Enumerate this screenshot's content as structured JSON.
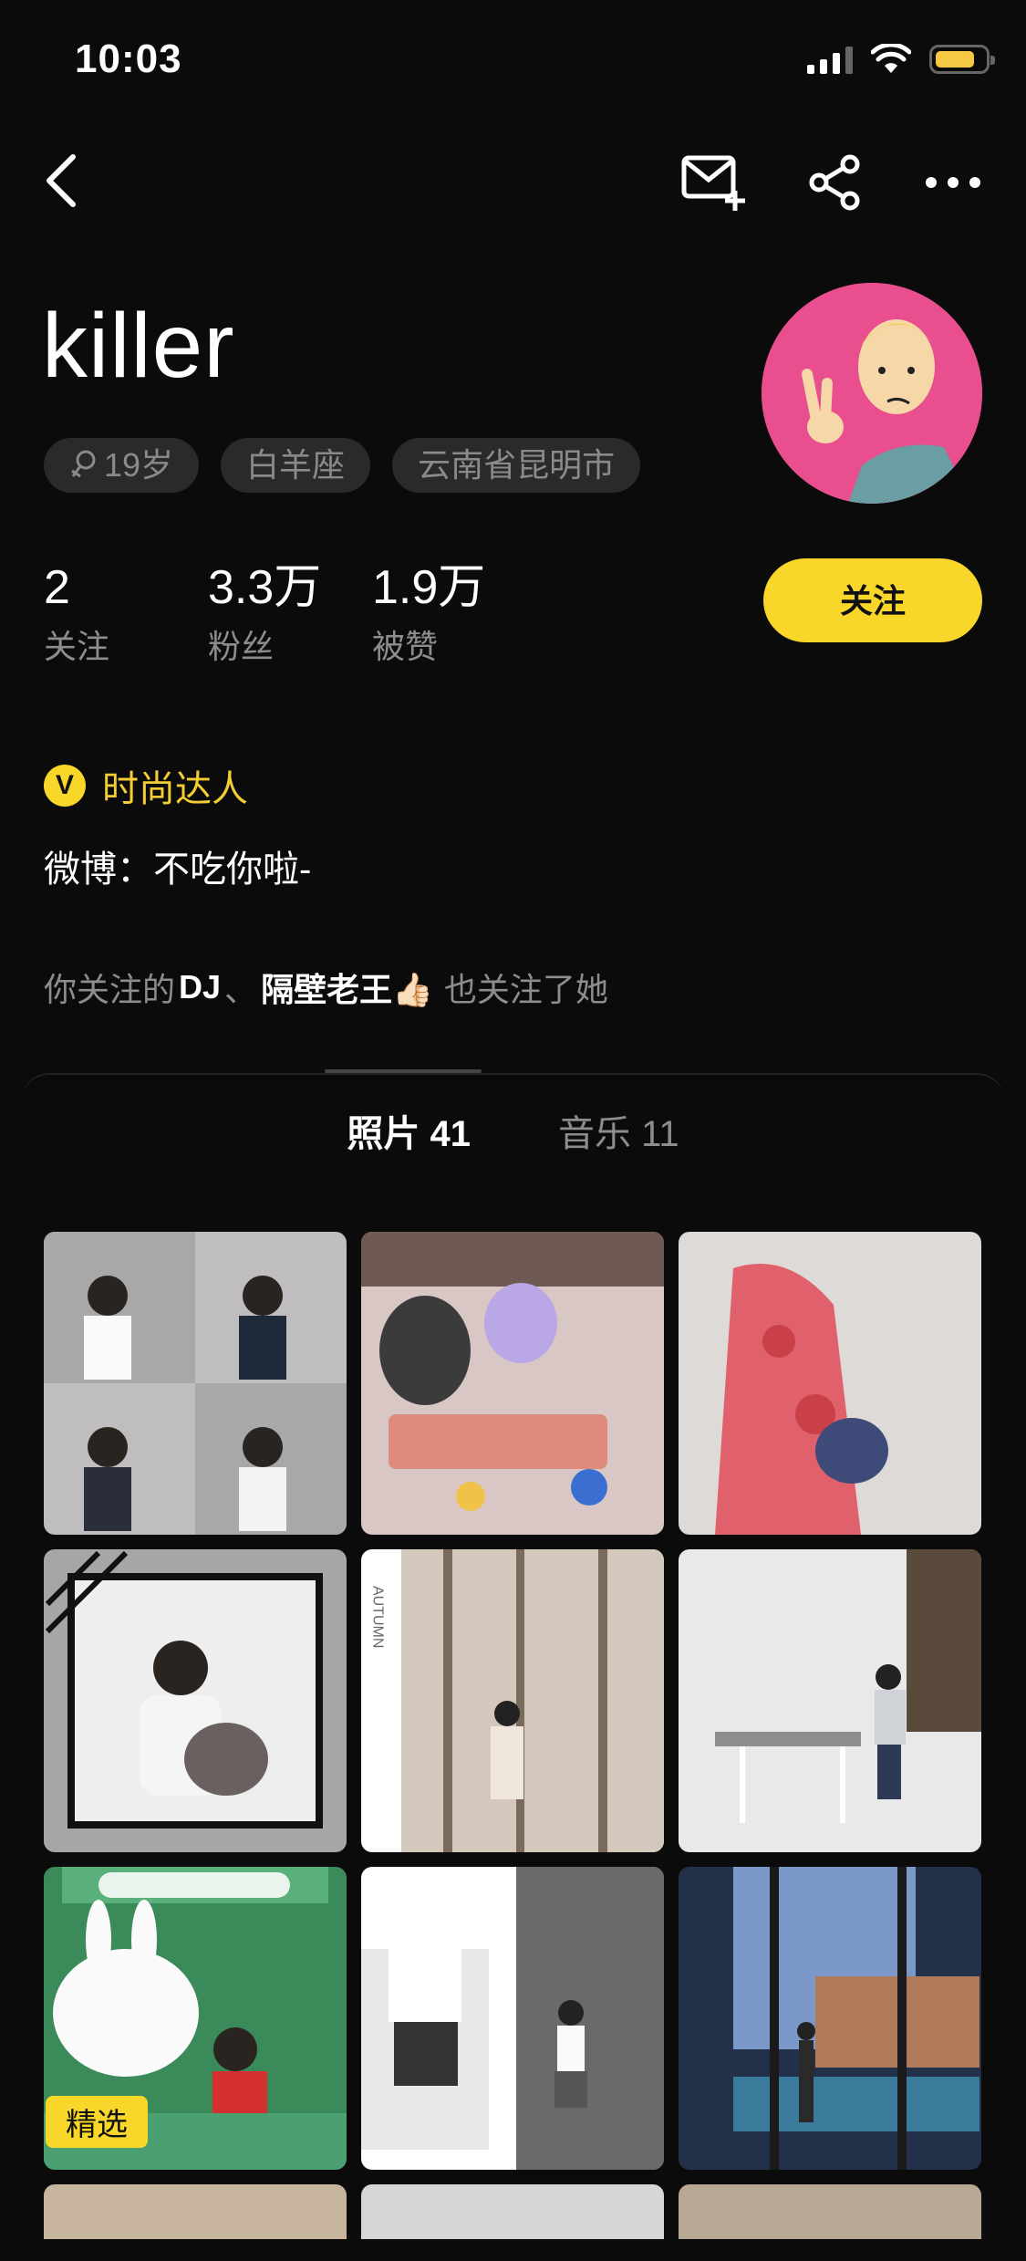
{
  "status_bar": {
    "time": "10:03"
  },
  "nav": {
    "back_icon": "chevron-left-icon",
    "actions": [
      "message-add-icon",
      "share-icon",
      "more-icon"
    ]
  },
  "profile": {
    "username": "killer",
    "tags": [
      {
        "icon": "female-icon",
        "label": "19岁"
      },
      {
        "label": "白羊座"
      },
      {
        "label": "云南省昆明市"
      }
    ],
    "stats": [
      {
        "value": "2",
        "label": "关注"
      },
      {
        "value": "3.3万",
        "label": "粉丝"
      },
      {
        "value": "1.9万",
        "label": "被赞"
      }
    ],
    "follow_label": "关注",
    "badge_letter": "V",
    "badge_text": "时尚达人",
    "bio": "微博：不吃你啦-",
    "mutual": {
      "prefix": "你关注的",
      "name1": "DJ",
      "separator": "、",
      "name2": "隔壁老王👍🏻",
      "suffix": "也关注了她"
    }
  },
  "tabs": [
    {
      "label": "照片 41",
      "active": true
    },
    {
      "label": "音乐 11",
      "active": false
    }
  ],
  "grid": {
    "featured_label": "精选",
    "photos": [
      "mirror-selfies",
      "plush-toys",
      "red-camo-hoodie",
      "portrait-with-cat",
      "autumn-trees",
      "cafe-chair",
      "line-friends-store",
      "checkered-skirt",
      "pool-window"
    ]
  },
  "colors": {
    "accent": "#f8d72a",
    "background": "#0b0b0b",
    "muted": "#8d8d8d"
  }
}
